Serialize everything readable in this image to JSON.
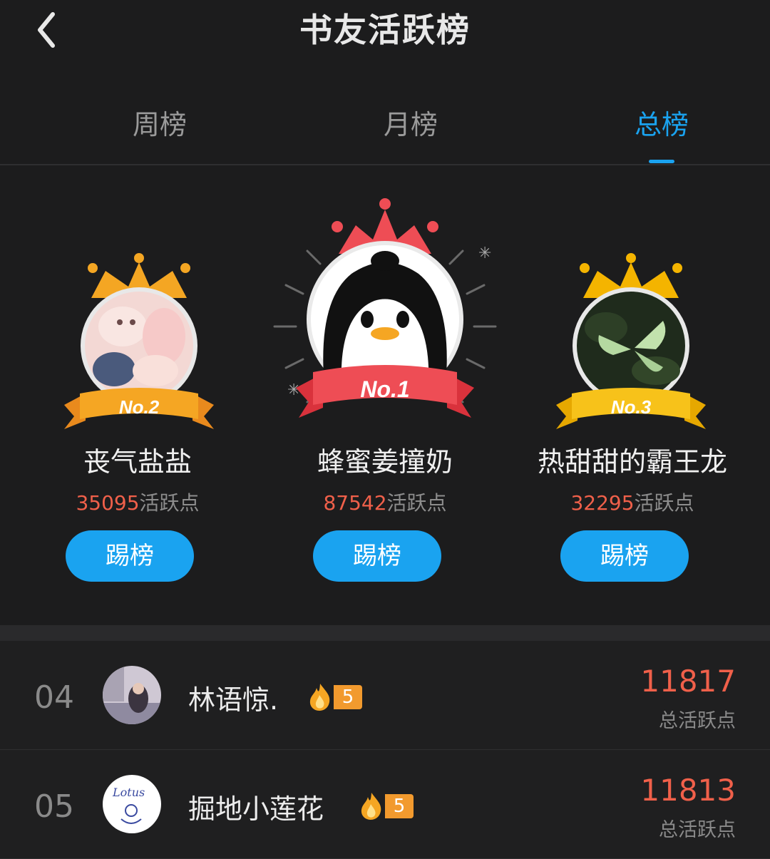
{
  "header": {
    "title": "书友活跃榜"
  },
  "tabs": [
    {
      "label": "周榜"
    },
    {
      "label": "月榜"
    },
    {
      "label": "总榜"
    }
  ],
  "podium": [
    {
      "badge": "No.2",
      "name": "丧气盐盐",
      "score": "35095",
      "score_suffix": "活跃点",
      "button": "踢榜"
    },
    {
      "badge": "No.1",
      "name": "蜂蜜姜撞奶",
      "score": "87542",
      "score_suffix": "活跃点",
      "button": "踢榜"
    },
    {
      "badge": "No.3",
      "name": "热甜甜的霸王龙",
      "score": "32295",
      "score_suffix": "活跃点",
      "button": "踢榜"
    }
  ],
  "list": [
    {
      "rank": "04",
      "name": "林语惊.",
      "level": "5",
      "score": "11817",
      "label": "总活跃点"
    },
    {
      "rank": "05",
      "name": "掘地小莲花",
      "level": "5",
      "score": "11813",
      "label": "总活跃点"
    }
  ],
  "colors": {
    "accent": "#1aa3f0",
    "score": "#f0604a",
    "gold_crown": "#f4a623",
    "red_crown": "#ee4d55",
    "bg": "#1c1c1d"
  }
}
